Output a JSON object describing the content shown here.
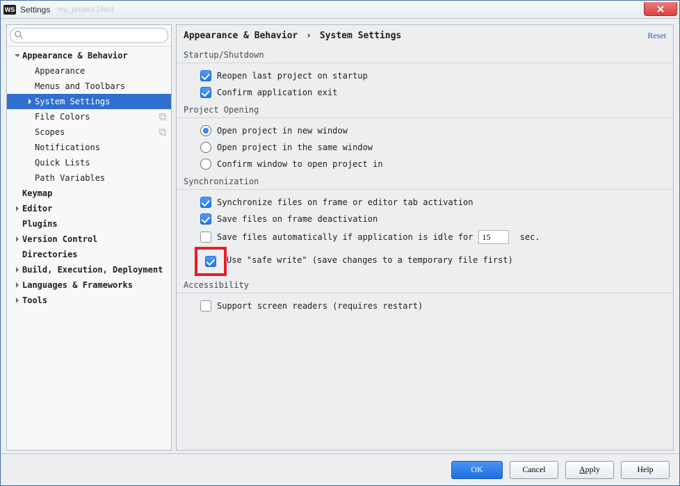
{
  "title": "Settings",
  "titlebar_ghost": "my_project [dev]",
  "reset_label": "Reset",
  "breadcrumb": {
    "a": "Appearance & Behavior",
    "sep": "›",
    "b": "System Settings"
  },
  "tree": [
    {
      "label": "Appearance & Behavior",
      "depth": 0,
      "bold": true,
      "expandable": true,
      "expanded": true
    },
    {
      "label": "Appearance",
      "depth": 1
    },
    {
      "label": "Menus and Toolbars",
      "depth": 1
    },
    {
      "label": "System Settings",
      "depth": 1,
      "expandable": true,
      "expanded": false,
      "selected": true
    },
    {
      "label": "File Colors",
      "depth": 1,
      "tagged": true
    },
    {
      "label": "Scopes",
      "depth": 1,
      "tagged": true
    },
    {
      "label": "Notifications",
      "depth": 1
    },
    {
      "label": "Quick Lists",
      "depth": 1
    },
    {
      "label": "Path Variables",
      "depth": 1
    },
    {
      "label": "Keymap",
      "depth": 0,
      "bold": true
    },
    {
      "label": "Editor",
      "depth": 0,
      "bold": true,
      "expandable": true
    },
    {
      "label": "Plugins",
      "depth": 0,
      "bold": true
    },
    {
      "label": "Version Control",
      "depth": 0,
      "bold": true,
      "expandable": true
    },
    {
      "label": "Directories",
      "depth": 0,
      "bold": true
    },
    {
      "label": "Build, Execution, Deployment",
      "depth": 0,
      "bold": true,
      "expandable": true
    },
    {
      "label": "Languages & Frameworks",
      "depth": 0,
      "bold": true,
      "expandable": true
    },
    {
      "label": "Tools",
      "depth": 0,
      "bold": true,
      "expandable": true
    }
  ],
  "sections": {
    "startup": {
      "title": "Startup/Shutdown",
      "reopen": "Reopen last project on startup",
      "confirm_exit": "Confirm application exit"
    },
    "opening": {
      "title": "Project Opening",
      "new_window": "Open project in new window",
      "same_window": "Open project in the same window",
      "confirm": "Confirm window to open project in"
    },
    "sync": {
      "title": "Synchronization",
      "sync_frame": "Synchronize files on frame or editor tab activation",
      "save_deact": "Save files on frame deactivation",
      "autosave_pre": "Save files automatically if application is idle for",
      "autosave_value": "15",
      "autosave_post": " sec.",
      "safe_write": "Use \"safe write\" (save changes to a temporary file first)"
    },
    "a11y": {
      "title": "Accessibility",
      "screen_readers": "Support screen readers (requires restart)"
    }
  },
  "buttons": {
    "ok": "OK",
    "cancel": "Cancel",
    "apply": "Apply",
    "help": "Help"
  }
}
